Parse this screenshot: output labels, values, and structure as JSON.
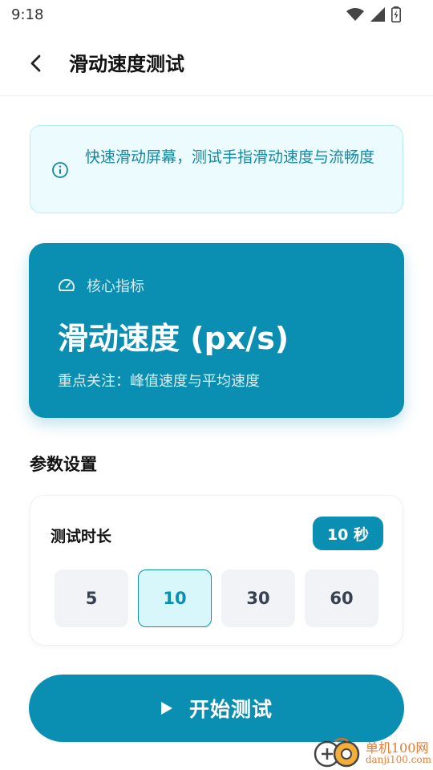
{
  "status_bar": {
    "time": "9:18",
    "icons": [
      "wifi-icon",
      "signal-icon",
      "battery-charging-icon"
    ]
  },
  "app_bar": {
    "back_icon": "chevron-left-icon",
    "title": "滑动速度测试"
  },
  "info": {
    "icon": "info-icon",
    "text": "快速滑动屏幕，测试手指滑动速度与流畅度"
  },
  "metric_card": {
    "icon": "speedometer-icon",
    "label": "核心指标",
    "value": "滑动速度 (px/s)",
    "note": "重点关注：峰值速度与平均速度"
  },
  "params": {
    "section_title": "参数设置",
    "duration_label": "测试时长",
    "duration_badge": "10 秒",
    "options": [
      {
        "label": "5",
        "selected": false
      },
      {
        "label": "10",
        "selected": true
      },
      {
        "label": "30",
        "selected": false
      },
      {
        "label": "60",
        "selected": false
      }
    ]
  },
  "start_button": {
    "icon": "play-icon",
    "label": "开始测试"
  },
  "watermark": {
    "cn": "单机100网",
    "en": "danji100.com"
  },
  "colors": {
    "primary": "#0a8fb2",
    "info_bg": "#ecfcfe",
    "info_text": "#1289a3",
    "option_bg": "#f1f3f6",
    "watermark": "#e86d1f"
  }
}
